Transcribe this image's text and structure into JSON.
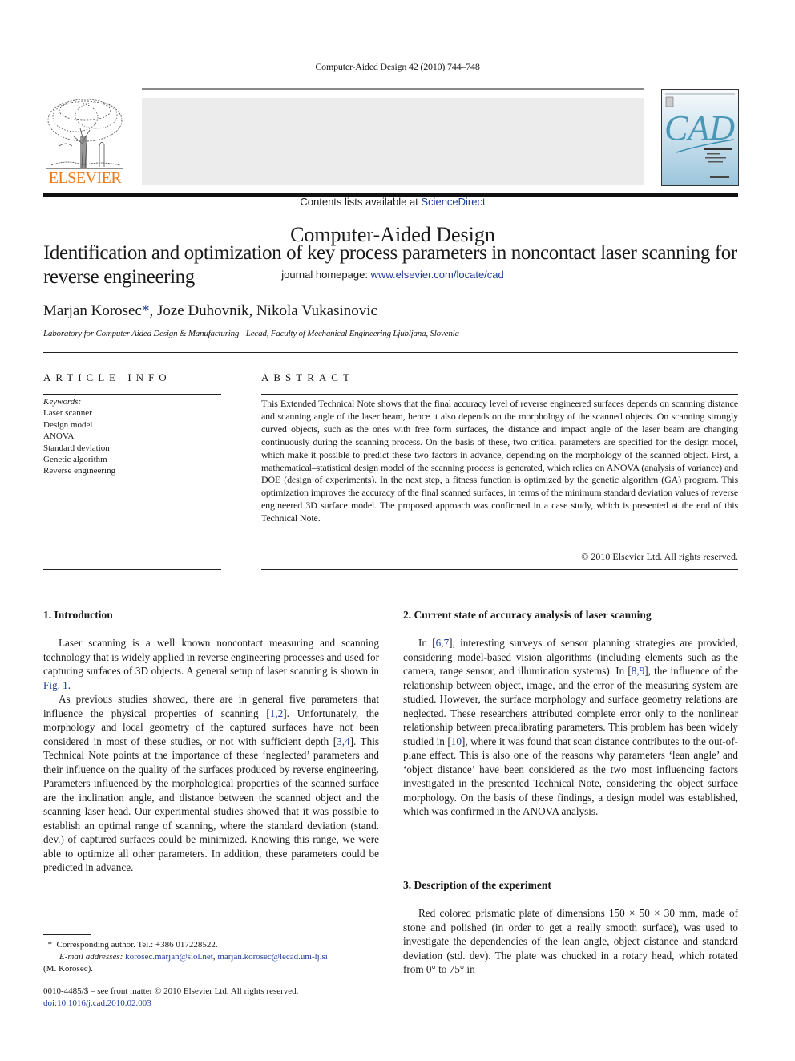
{
  "running_head": "Computer-Aided Design 42 (2010) 744–748",
  "masthead": {
    "publisher": "ELSEVIER",
    "contents_prefix": "Contents lists available at ",
    "contents_link": "ScienceDirect",
    "journal_name": "Computer-Aided Design",
    "homepage_prefix": "journal homepage: ",
    "homepage_link": "www.elsevier.com/locate/cad",
    "cover_title": "CAD",
    "brand_colors": {
      "elsevier_orange": "#f07a1a",
      "link_blue": "#1f3d99",
      "banner_grey": "#ececec"
    }
  },
  "article": {
    "title": "Identification and optimization of key process parameters in noncontact laser scanning for reverse engineering",
    "authors": [
      {
        "name": "Marjan Korosec",
        "corresponding_mark": "*"
      },
      {
        "name": "Joze Duhovnik"
      },
      {
        "name": "Nikola Vukasinovic"
      }
    ],
    "affiliation": "Laboratory for Computer Aided Design & Manufacturing - Lecad, Faculty of Mechanical Engineering Ljubljana, Slovenia"
  },
  "article_info": {
    "heading": "ARTICLE INFO",
    "keywords_label": "Keywords:",
    "keywords": [
      "Laser scanner",
      "Design model",
      "ANOVA",
      "Standard deviation",
      "Genetic algorithm",
      "Reverse engineering"
    ]
  },
  "abstract": {
    "heading": "ABSTRACT",
    "text": "This Extended Technical Note shows that the final accuracy level of reverse engineered surfaces depends on scanning distance and scanning angle of the laser beam, hence it also depends on the morphology of the scanned objects. On scanning strongly curved objects, such as the ones with free form surfaces, the distance and impact angle of the laser beam are changing continuously during the scanning process. On the basis of these, two critical parameters are specified for the design model, which make it possible to predict these two factors in advance, depending on the morphology of the scanned object. First, a mathematical–statistical design model of the scanning process is generated, which relies on ANOVA (analysis of variance) and DOE (design of experiments). In the next step, a fitness function is optimized by the genetic algorithm (GA) program. This optimization improves the accuracy of the final scanned surfaces, in terms of the minimum standard deviation values of reverse engineered 3D surface model. The proposed approach was confirmed in a case study, which is presented at the end of this Technical Note.",
    "copyright": "© 2010 Elsevier Ltd. All rights reserved."
  },
  "sections": [
    {
      "heading": "1.  Introduction",
      "paragraphs": [
        [
          {
            "t": "Laser scanning is a well known noncontact measuring and scanning technology that is widely applied in reverse engineering processes and used for capturing surfaces of 3D objects. A general setup of laser scanning is shown in "
          },
          {
            "t": "Fig. 1",
            "link": true
          },
          {
            "t": "."
          }
        ],
        [
          {
            "t": "As previous studies showed, there are in general five parameters that influence the physical properties of scanning ["
          },
          {
            "t": "1,2",
            "link": true
          },
          {
            "t": "]. Unfortunately, the morphology and local geometry of the captured surfaces have not been considered in most of these studies, or not with sufficient depth ["
          },
          {
            "t": "3,4",
            "link": true
          },
          {
            "t": "]. This Technical Note points at the importance of these ‘neglected’ parameters and their influence on the quality of the surfaces produced by reverse engineering. Parameters influenced by the morphological properties of the scanned surface are the inclination angle, and distance between the scanned object and the scanning laser head. Our experimental studies showed that it was possible to establish an optimal range of scanning, where the standard deviation (stand. dev.) of captured surfaces could be minimized. Knowing this range, we were able to optimize all other parameters. In addition, these parameters could be predicted in advance."
          }
        ]
      ]
    },
    {
      "heading": "2.  Current state of accuracy analysis of laser scanning",
      "paragraphs": [
        [
          {
            "t": "In ["
          },
          {
            "t": "6,7",
            "link": true
          },
          {
            "t": "], interesting surveys of sensor planning strategies are provided, considering model-based vision algorithms (including elements such as the camera, range sensor, and illumination systems). In ["
          },
          {
            "t": "8,9",
            "link": true
          },
          {
            "t": "], the influence of the relationship between object, image, and the error of the measuring system are studied. However, the surface morphology and  surface geometry relations are neglected. These researchers attributed complete error only to the nonlinear relationship between precalibrating parameters. This problem has been widely studied in ["
          },
          {
            "t": "10",
            "link": true
          },
          {
            "t": "], where it was found that scan distance contributes to the out-of-plane effect. This is also one of the reasons why parameters ‘lean angle’ and ‘object distance’ have been considered as the two most influencing factors investigated in the presented Technical Note, considering the object surface morphology. On the basis of these findings, a design model was established, which was confirmed in the ANOVA analysis."
          }
        ]
      ]
    },
    {
      "heading": "3.  Description of the experiment",
      "paragraphs": [
        [
          {
            "t": "Red colored prismatic plate of dimensions 150 × 50 × 30 mm, made of stone and polished (in order to get a really smooth surface), was used to investigate the dependencies of the lean angle, object distance and standard deviation (std. dev). The plate was chucked in a rotary head, which rotated from 0° to 75° in"
          }
        ]
      ]
    }
  ],
  "footnote": {
    "mark": "*",
    "corresponding": "Corresponding author. Tel.: +386 017228522.",
    "email_label": "E-mail addresses:",
    "emails": [
      "korosec.marjan@siol.net",
      "marjan.korosec@lecad.uni-lj.si"
    ],
    "email_owner": "(M. Korosec)."
  },
  "front_matter": {
    "issn_line": "0010-4485/$ – see front matter © 2010 Elsevier Ltd. All rights reserved.",
    "doi": "doi:10.1016/j.cad.2010.02.003"
  }
}
